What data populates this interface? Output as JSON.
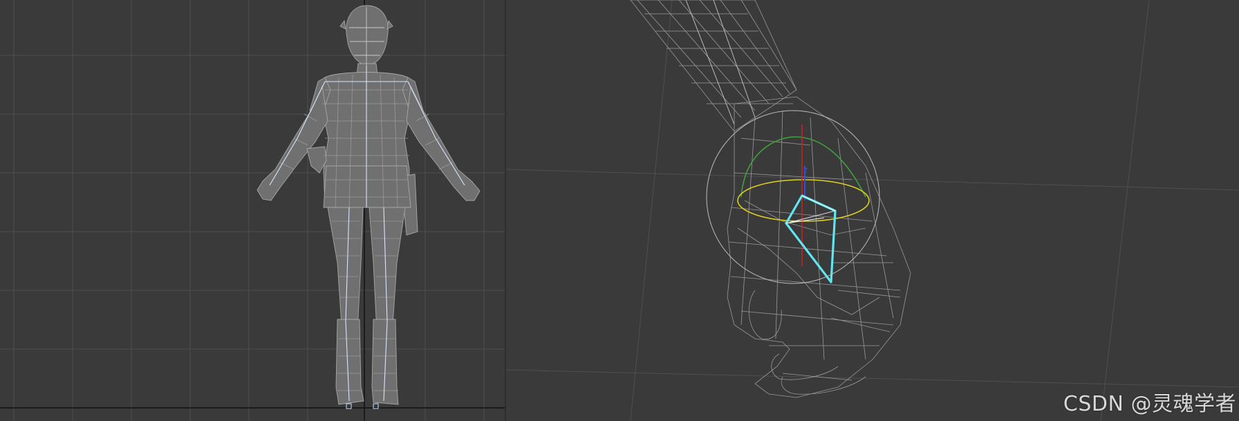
{
  "watermark": "CSDN @灵魂学者",
  "viewports": {
    "front": {
      "content": "wireframe-character"
    },
    "perspective": {
      "content": "wireframe-hand-with-selected-bone"
    }
  },
  "colors": {
    "viewport_bg": "#3a3a3a",
    "grid": "#4f4f4f",
    "wire": "#9a9a9a",
    "selected_bone": "#5fe6f0",
    "gizmo_x": "#d42020",
    "gizmo_y": "#3fa03f",
    "gizmo_z": "#3050e0",
    "gizmo_ring": "#e0d020"
  }
}
